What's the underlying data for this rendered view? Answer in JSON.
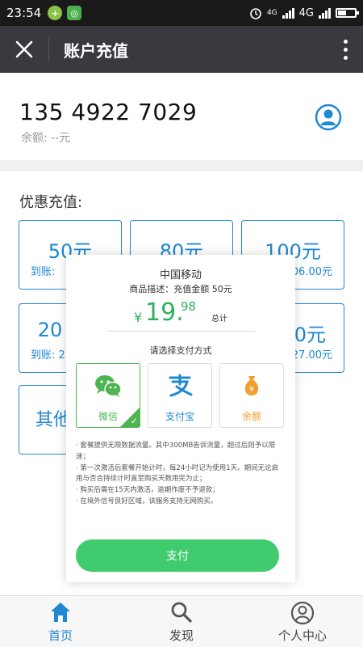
{
  "status_bar": {
    "time": "23:54",
    "network_4g_small": "4G",
    "network_4g": "4G"
  },
  "header": {
    "title": "账户充值"
  },
  "account": {
    "phone": "135 4922 7029",
    "balance": "余额: --元"
  },
  "packages": {
    "title": "优惠充值:",
    "items": [
      {
        "amount": "50元",
        "arrival": "到账:"
      },
      {
        "amount": "80元",
        "arrival": ""
      },
      {
        "amount": "100元",
        "arrival": "06.00元"
      },
      {
        "amount": "20",
        "arrival": "到账: 2"
      },
      {
        "amount": "0元",
        "arrival": "27.00元"
      },
      {
        "amount": "其他",
        "arrival": ""
      }
    ]
  },
  "payment": {
    "carrier": "中国移动",
    "description": "商品描述：充值金额 50元",
    "currency": "¥",
    "price_integer": "19.",
    "price_decimal": "98",
    "total_label": "总计",
    "choose_method": "请选择支付方式",
    "methods": [
      {
        "label": "微信",
        "selected": true,
        "color": "#4cb450"
      },
      {
        "label": "支付宝",
        "selected": false,
        "color": "#1e88d2"
      },
      {
        "label": "余额",
        "selected": false,
        "color": "#f0a030"
      }
    ],
    "notes": [
      "· 套餐提供无限数据流量。其中300MB告诉流量，超过后则予以限速；",
      "· 第一次激活后套餐开始计时，每24小时记为使用1天。期间无论启用与否合持续计时直至购买天数用完为止；",
      "· 购买后需在15天内激活，逾期作废不予退款；",
      "· 在境外信号良好区域，该服务支持无网购买。"
    ],
    "pay_button": "支付"
  },
  "nav": {
    "items": [
      {
        "label": "首页",
        "active": true
      },
      {
        "label": "发现",
        "active": false
      },
      {
        "label": "个人中心",
        "active": false
      }
    ]
  },
  "colors": {
    "accent": "#1e88d2",
    "pay_green": "#3fcb6e",
    "wechat_green": "#4cb450",
    "titlebar": "#393a3f"
  }
}
